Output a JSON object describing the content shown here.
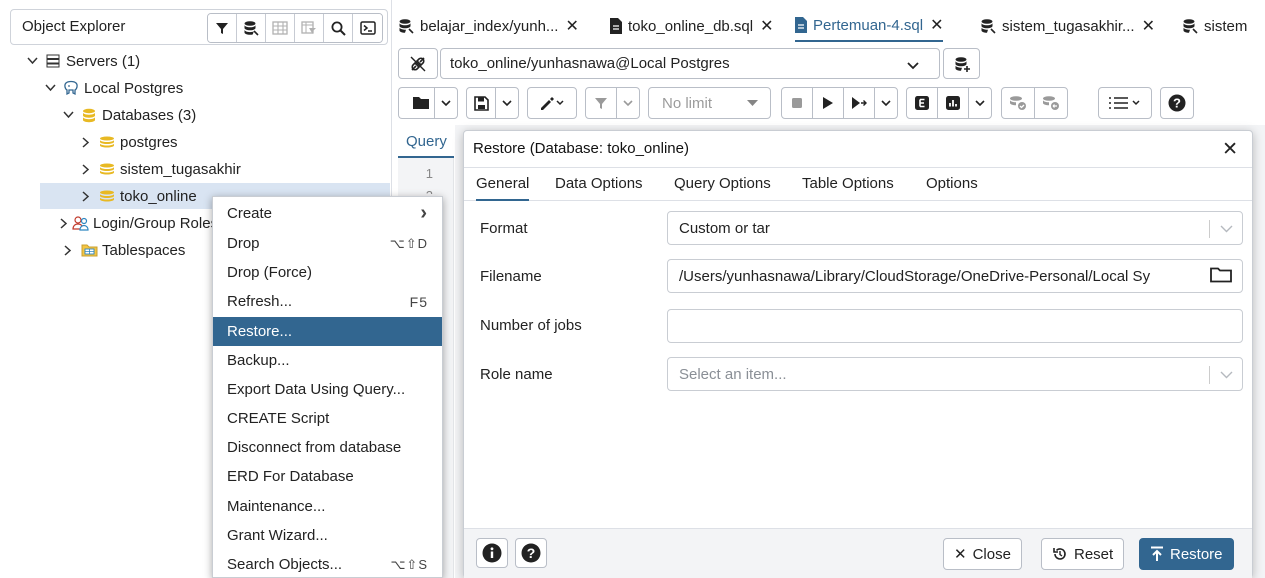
{
  "explorer": {
    "title": "Object Explorer",
    "tools": [
      "filter-icon",
      "query-tool-icon",
      "table-view-icon",
      "table-filter-icon",
      "search-icon",
      "terminal-icon"
    ],
    "tree": [
      {
        "label": "Servers (1)",
        "icon": "server-group-icon",
        "expanded": true
      },
      {
        "label": "Local Postgres",
        "icon": "postgres-elephant-icon",
        "expanded": true
      },
      {
        "label": "Databases (3)",
        "icon": "databases-icon",
        "expanded": true
      },
      {
        "label": "postgres",
        "icon": "database-icon",
        "expanded": false
      },
      {
        "label": "sistem_tugasakhir",
        "icon": "database-icon",
        "expanded": false
      },
      {
        "label": "toko_online",
        "icon": "database-icon",
        "expanded": false,
        "selected": true
      },
      {
        "label": "Login/Group Roles",
        "icon": "roles-icon",
        "expanded": false
      },
      {
        "label": "Tablespaces",
        "icon": "tablespace-folder-icon",
        "expanded": false
      }
    ]
  },
  "context_menu": {
    "items": [
      {
        "label": "Create",
        "shortcut": "›"
      },
      {
        "label": "Drop",
        "shortcut": "⌥⇧D"
      },
      {
        "label": "Drop (Force)",
        "shortcut": ""
      },
      {
        "label": "Refresh...",
        "shortcut": "F5"
      },
      {
        "label": "Restore...",
        "shortcut": "",
        "active": true
      },
      {
        "label": "Backup...",
        "shortcut": ""
      },
      {
        "label": "Export Data Using Query...",
        "shortcut": ""
      },
      {
        "label": "CREATE Script",
        "shortcut": ""
      },
      {
        "label": "Disconnect from database",
        "shortcut": ""
      },
      {
        "label": "ERD For Database",
        "shortcut": ""
      },
      {
        "label": "Maintenance...",
        "shortcut": ""
      },
      {
        "label": "Grant Wizard...",
        "shortcut": ""
      },
      {
        "label": "Search Objects...",
        "shortcut": "⌥⇧S"
      }
    ]
  },
  "tabs": [
    {
      "label": "belajar_index/yunh...",
      "icon": "query-tool-icon",
      "active": false
    },
    {
      "label": "toko_online_db.sql",
      "icon": "file-icon",
      "active": false
    },
    {
      "label": "Pertemuan-4.sql",
      "icon": "file-icon",
      "active": true
    },
    {
      "label": "sistem_tugasakhir...",
      "icon": "query-tool-icon",
      "active": false
    },
    {
      "label": "sistem",
      "icon": "query-tool-icon",
      "active": false
    }
  ],
  "connection": {
    "value": "toko_online/yunhasnawa@Local Postgres"
  },
  "toolbar": {
    "limit_label": "No limit"
  },
  "editor": {
    "tab_label": "Query",
    "line_numbers": [
      "1",
      "2"
    ]
  },
  "dialog": {
    "title": "Restore (Database: toko_online)",
    "tabs": [
      "General",
      "Data Options",
      "Query Options",
      "Table Options",
      "Options"
    ],
    "active_tab": "General",
    "fields": {
      "format_label": "Format",
      "format_value": "Custom or tar",
      "filename_label": "Filename",
      "filename_value": "/Users/yunhasnawa/Library/CloudStorage/OneDrive-Personal/Local Sy",
      "jobs_label": "Number of jobs",
      "jobs_value": "",
      "role_label": "Role name",
      "role_placeholder": "Select an item..."
    },
    "buttons": {
      "close": "Close",
      "reset": "Reset",
      "restore": "Restore"
    }
  },
  "colors": {
    "accent": "#326690",
    "db_icon": "#e8b923"
  }
}
